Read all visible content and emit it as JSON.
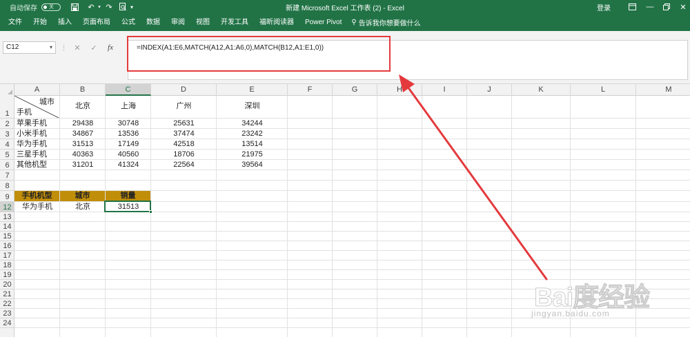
{
  "app": {
    "autosave_label": "自动保存",
    "autosave_state": "关",
    "title": "新建 Microsoft Excel 工作表 (2)  -  Excel",
    "login": "登录"
  },
  "ribbon": {
    "tabs": [
      "文件",
      "开始",
      "插入",
      "页面布局",
      "公式",
      "数据",
      "审阅",
      "视图",
      "开发工具",
      "福昕阅读器",
      "Power Pivot"
    ],
    "tell_me": "告诉我你想要做什么"
  },
  "formula_bar": {
    "name_box": "C12",
    "fx_label": "fx",
    "formula": "=INDEX(A1:E6,MATCH(A12,A1:A6,0),MATCH(B12,A1:E1,0))"
  },
  "sheet": {
    "columns": [
      "A",
      "B",
      "C",
      "D",
      "E",
      "F",
      "G",
      "H",
      "I",
      "J",
      "K",
      "L",
      "M"
    ],
    "selected_column": "C",
    "rows": [
      "1",
      "2",
      "3",
      "4",
      "5",
      "6",
      "7",
      "8",
      "9",
      "12",
      "13",
      "14",
      "15",
      "16",
      "17",
      "18",
      "19",
      "20",
      "21",
      "22",
      "23",
      "24"
    ],
    "selected_row": "12",
    "corner_top": "城市",
    "corner_bottom": "手机",
    "cities": [
      "北京",
      "上海",
      "广州",
      "深圳"
    ],
    "data_rows": [
      {
        "label": "苹果手机",
        "values": [
          "29438",
          "30748",
          "25631",
          "34244"
        ]
      },
      {
        "label": "小米手机",
        "values": [
          "34867",
          "13536",
          "37474",
          "23242"
        ]
      },
      {
        "label": "华为手机",
        "values": [
          "31513",
          "17149",
          "42518",
          "13514"
        ]
      },
      {
        "label": "三星手机",
        "values": [
          "40363",
          "40560",
          "18706",
          "21975"
        ]
      },
      {
        "label": "其他机型",
        "values": [
          "31201",
          "41324",
          "22564",
          "39564"
        ]
      }
    ],
    "lookup_headers": [
      "手机机型",
      "城市",
      "销量"
    ],
    "lookup_values": [
      "华为手机",
      "北京",
      "31513"
    ]
  },
  "watermark": {
    "brand": "Bai度经验",
    "url": "jingyan.baidu.com"
  },
  "colors": {
    "excel_green": "#217346",
    "header_fill": "#c18e0a",
    "annotation_red": "#e43a3d"
  }
}
